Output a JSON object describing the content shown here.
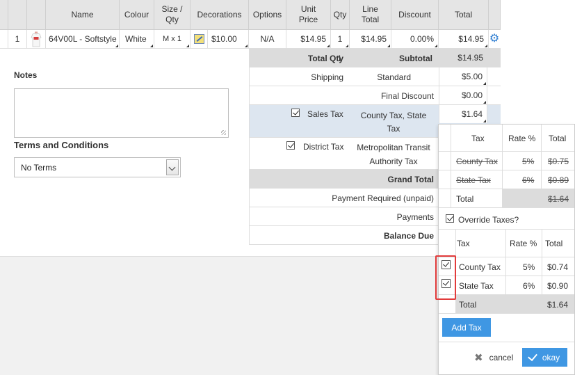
{
  "table": {
    "headers": {
      "name": "Name",
      "colour": "Colour",
      "size_qty": "Size / Qty",
      "decorations": "Decorations",
      "options": "Options",
      "unit_price": "Unit Price",
      "qty": "Qty",
      "line_total": "Line Total",
      "discount": "Discount",
      "total": "Total"
    },
    "row": {
      "index": "1",
      "name": "64V00L - Softstyle",
      "colour": "White",
      "size_qty": "M x 1",
      "decorations_price": "$10.00",
      "options": "N/A",
      "unit_price": "$14.95",
      "qty": "1",
      "line_total": "$14.95",
      "discount": "0.00%",
      "total": "$14.95"
    }
  },
  "summary": {
    "total_qty_label": "Total Qty",
    "total_qty": "1",
    "subtotal_label": "Subtotal",
    "subtotal": "$14.95",
    "shipping_label": "Shipping",
    "shipping_method": "Standard",
    "shipping": "$5.00",
    "final_discount_label": "Final Discount",
    "final_discount": "$0.00",
    "sales_tax_label": "Sales Tax",
    "sales_tax_desc": "County Tax, State Tax",
    "sales_tax": "$1.64",
    "district_tax_label": "District Tax",
    "district_tax_desc": "Metropolitan Transit Authority Tax",
    "grand_total_label": "Grand Total",
    "payment_required_label": "Payment Required (unpaid)",
    "payments_label": "Payments",
    "balance_due_label": "Balance Due"
  },
  "notes": {
    "label": "Notes",
    "value": "",
    "terms_label": "Terms and Conditions",
    "terms_value": "No Terms"
  },
  "popup": {
    "headers": {
      "tax": "Tax",
      "rate": "Rate %",
      "total": "Total"
    },
    "computed": [
      {
        "tax": "County Tax",
        "rate": "5%",
        "total": "$0.75"
      },
      {
        "tax": "State Tax",
        "rate": "6%",
        "total": "$0.89"
      }
    ],
    "computed_total_label": "Total",
    "computed_total": "$1.64",
    "override_label": "Override Taxes?",
    "override": [
      {
        "tax": "County Tax",
        "rate": "5%",
        "total": "$0.74"
      },
      {
        "tax": "State Tax",
        "rate": "6%",
        "total": "$0.90"
      }
    ],
    "override_total_label": "Total",
    "override_total": "$1.64",
    "add_tax": "Add Tax",
    "cancel": "cancel",
    "okay": "okay"
  },
  "icons": {
    "row_settings": "gear-icon",
    "decoration": "decoration-edit-icon",
    "product": "tshirt-thumbnail",
    "cancel": "close-icon",
    "okay": "check-icon"
  },
  "colors": {
    "accent": "#3f97e3",
    "highlight": "#e23b3b",
    "header_bg": "#e5e5e5",
    "selected_row": "#dde6f0"
  }
}
